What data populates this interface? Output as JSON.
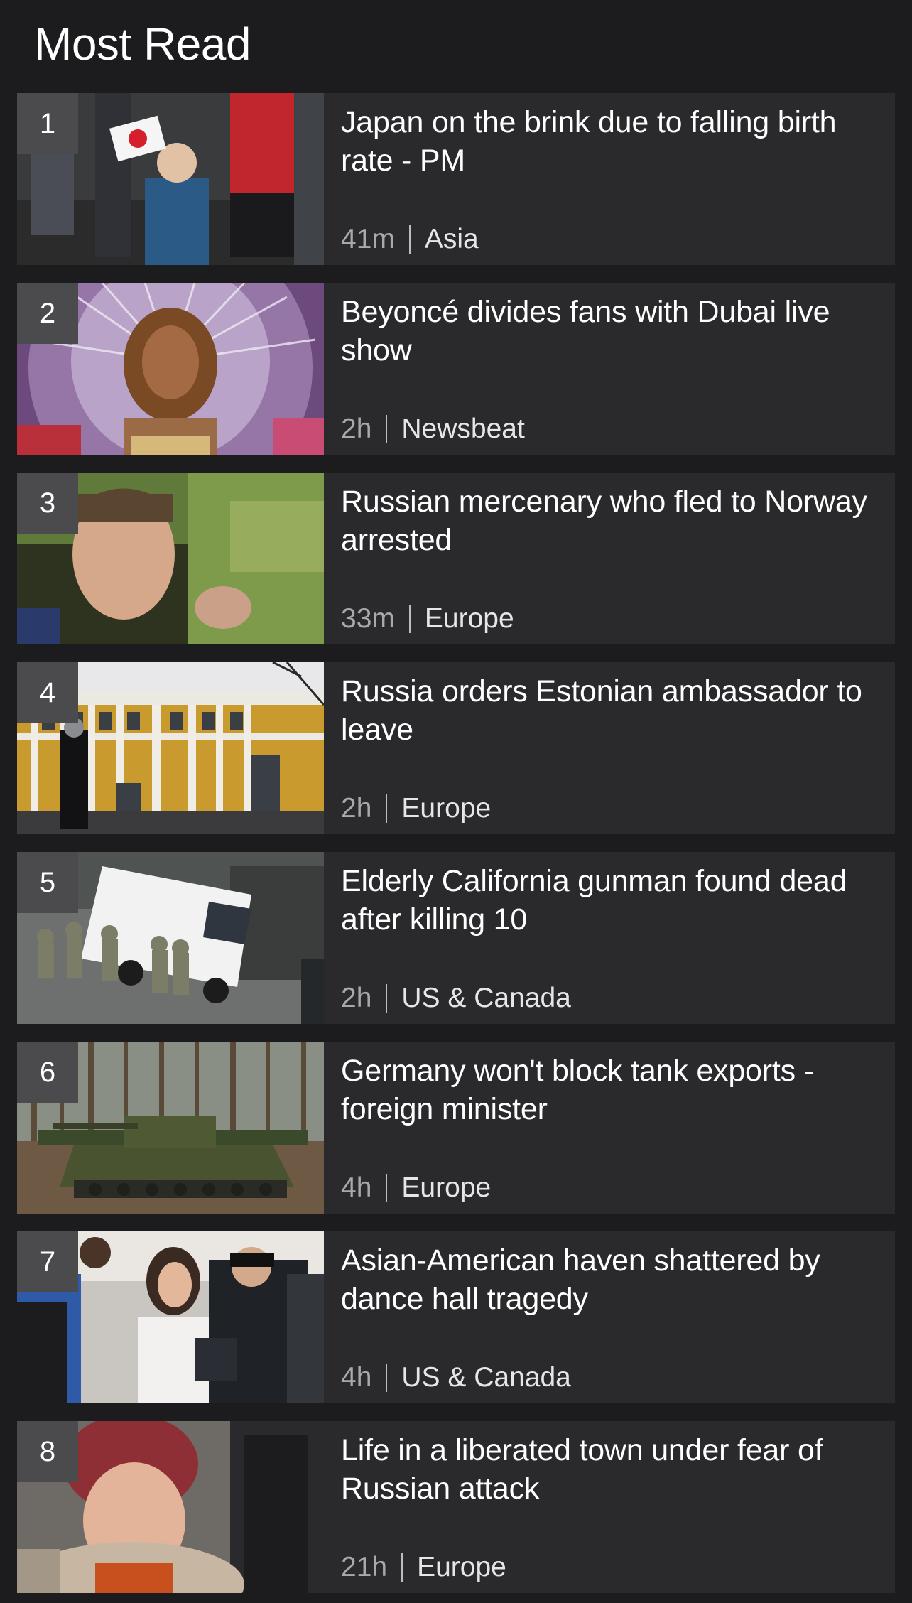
{
  "header": {
    "title": "Most Read"
  },
  "articles": [
    {
      "rank": "1",
      "headline": "Japan on the brink due to falling birth rate - PM",
      "time": "41m",
      "section": "Asia"
    },
    {
      "rank": "2",
      "headline": "Beyoncé divides fans with Dubai live show",
      "time": "2h",
      "section": "Newsbeat"
    },
    {
      "rank": "3",
      "headline": "Russian mercenary who fled to Norway arrested",
      "time": "33m",
      "section": "Europe"
    },
    {
      "rank": "4",
      "headline": "Russia orders Estonian ambassador to leave",
      "time": "2h",
      "section": "Europe"
    },
    {
      "rank": "5",
      "headline": "Elderly California gunman found dead after killing 10",
      "time": "2h",
      "section": "US & Canada"
    },
    {
      "rank": "6",
      "headline": "Germany won't block tank exports - foreign minister",
      "time": "4h",
      "section": "Europe"
    },
    {
      "rank": "7",
      "headline": "Asian-American haven shattered by dance hall tragedy",
      "time": "4h",
      "section": "US & Canada"
    },
    {
      "rank": "8",
      "headline": "Life in a liberated town under fear of Russian attack",
      "time": "21h",
      "section": "Europe"
    }
  ],
  "colors": {
    "background": "#1c1c1e",
    "card": "#2a2a2c",
    "rank_badge": "#4b4b4d",
    "text": "#ffffff",
    "meta": "#bdbdbf"
  }
}
